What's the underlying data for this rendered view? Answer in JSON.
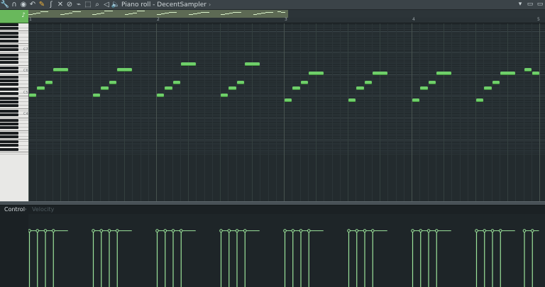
{
  "window": {
    "title": "Piano roll - DecentSampler",
    "title_arrow": "›",
    "buttons": [
      {
        "name": "menu-button",
        "glyph": "▾"
      },
      {
        "name": "maximize-button",
        "glyph": "▭"
      },
      {
        "name": "close-button",
        "glyph": "▭"
      }
    ]
  },
  "toolbar": {
    "tools": [
      {
        "name": "tools-wrench-icon",
        "glyph": "🔧"
      },
      {
        "name": "magnet-icon",
        "glyph": "∩"
      },
      {
        "name": "record-icon",
        "glyph": "◉"
      },
      {
        "name": "undo-icon",
        "glyph": "↶"
      },
      {
        "name": "draw-pencil-icon",
        "glyph": "✎",
        "accent": true
      },
      {
        "name": "paint-brush-icon",
        "glyph": "ʃ"
      },
      {
        "name": "delete-icon",
        "glyph": "✕"
      },
      {
        "name": "mute-icon",
        "glyph": "⊘"
      },
      {
        "name": "slice-icon",
        "glyph": "⌁"
      },
      {
        "name": "select-icon",
        "glyph": "⬚"
      },
      {
        "name": "zoom-icon",
        "glyph": "⌕"
      },
      {
        "name": "playback-speaker-icon",
        "glyph": "◁"
      }
    ],
    "speaker_glyph": "🔈"
  },
  "ruler": {
    "bars": [
      "1",
      "2",
      "3",
      "4",
      "5"
    ]
  },
  "keyboard": {
    "octave_labels": [
      "C7",
      "C6",
      "C5",
      "C4"
    ]
  },
  "corner": {
    "glyph": "♪"
  },
  "notes": [
    {
      "bar": 1,
      "beat": 0.0,
      "pitch": "C5",
      "length": 0.25
    },
    {
      "bar": 1,
      "beat": 0.25,
      "pitch": "E5",
      "length": 0.25
    },
    {
      "bar": 1,
      "beat": 0.5,
      "pitch": "G5",
      "length": 0.25
    },
    {
      "bar": 1,
      "beat": 0.75,
      "pitch": "D6",
      "length": 0.5
    },
    {
      "bar": 1,
      "beat": 2.0,
      "pitch": "C5",
      "length": 0.25
    },
    {
      "bar": 1,
      "beat": 2.25,
      "pitch": "E5",
      "length": 0.25
    },
    {
      "bar": 1,
      "beat": 2.5,
      "pitch": "G5",
      "length": 0.25
    },
    {
      "bar": 1,
      "beat": 2.75,
      "pitch": "D6",
      "length": 0.5
    },
    {
      "bar": 2,
      "beat": 0.0,
      "pitch": "C5",
      "length": 0.25
    },
    {
      "bar": 2,
      "beat": 0.25,
      "pitch": "E5",
      "length": 0.25
    },
    {
      "bar": 2,
      "beat": 0.5,
      "pitch": "G5",
      "length": 0.25
    },
    {
      "bar": 2,
      "beat": 0.75,
      "pitch": "F6",
      "length": 0.5
    },
    {
      "bar": 2,
      "beat": 2.0,
      "pitch": "C5",
      "length": 0.25
    },
    {
      "bar": 2,
      "beat": 2.25,
      "pitch": "E5",
      "length": 0.25
    },
    {
      "bar": 2,
      "beat": 2.5,
      "pitch": "G5",
      "length": 0.25
    },
    {
      "bar": 2,
      "beat": 2.75,
      "pitch": "F6",
      "length": 0.5
    },
    {
      "bar": 3,
      "beat": 0.0,
      "pitch": "A4",
      "length": 0.25
    },
    {
      "bar": 3,
      "beat": 0.25,
      "pitch": "E5",
      "length": 0.25
    },
    {
      "bar": 3,
      "beat": 0.5,
      "pitch": "G5",
      "length": 0.25
    },
    {
      "bar": 3,
      "beat": 0.75,
      "pitch": "C6",
      "length": 0.5
    },
    {
      "bar": 3,
      "beat": 2.0,
      "pitch": "A4",
      "length": 0.25
    },
    {
      "bar": 3,
      "beat": 2.25,
      "pitch": "E5",
      "length": 0.25
    },
    {
      "bar": 3,
      "beat": 2.5,
      "pitch": "G5",
      "length": 0.25
    },
    {
      "bar": 3,
      "beat": 2.75,
      "pitch": "C6",
      "length": 0.5
    },
    {
      "bar": 4,
      "beat": 0.0,
      "pitch": "A4",
      "length": 0.25
    },
    {
      "bar": 4,
      "beat": 0.25,
      "pitch": "E5",
      "length": 0.25
    },
    {
      "bar": 4,
      "beat": 0.5,
      "pitch": "G5",
      "length": 0.25
    },
    {
      "bar": 4,
      "beat": 0.75,
      "pitch": "C6",
      "length": 0.5
    },
    {
      "bar": 4,
      "beat": 2.0,
      "pitch": "A4",
      "length": 0.25
    },
    {
      "bar": 4,
      "beat": 2.25,
      "pitch": "E5",
      "length": 0.25
    },
    {
      "bar": 4,
      "beat": 2.5,
      "pitch": "G5",
      "length": 0.25
    },
    {
      "bar": 4,
      "beat": 2.75,
      "pitch": "C6",
      "length": 0.5
    },
    {
      "bar": 4,
      "beat": 3.5,
      "pitch": "D6",
      "length": 0.25
    },
    {
      "bar": 4,
      "beat": 3.75,
      "pitch": "C6",
      "length": 0.25
    }
  ],
  "control": {
    "label": "Control",
    "arrow": "›",
    "parameter": "Velocity",
    "velocities": [
      0.8,
      0.8,
      0.8,
      0.8,
      0.8,
      0.8,
      0.8,
      0.8,
      0.8,
      0.8,
      0.8,
      0.8,
      0.8,
      0.8,
      0.8,
      0.8,
      0.8,
      0.8,
      0.8,
      0.8,
      0.8,
      0.8,
      0.8,
      0.8,
      0.8,
      0.8,
      0.8,
      0.8,
      0.8,
      0.8,
      0.8,
      0.8,
      0.8,
      0.8
    ]
  },
  "colors": {
    "note": "#6fcf6a",
    "velocity": "#9be39a",
    "accent": "#69b85c"
  }
}
